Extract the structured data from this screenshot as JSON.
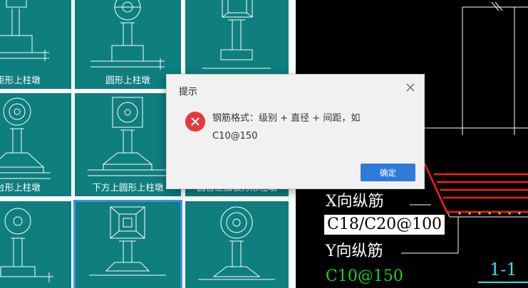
{
  "gallery": {
    "tiles": [
      {
        "label": "矩形上柱墩"
      },
      {
        "label": "圆形上柱墩"
      },
      {
        "label": ""
      },
      {
        "label": "台形上柱墩"
      },
      {
        "label": "下方上圆形上柱墩"
      },
      {
        "label": "圆台上加板方形柱墩"
      },
      {
        "label": ""
      },
      {
        "label": ""
      },
      {
        "label": ""
      }
    ],
    "selected_index": 7
  },
  "cad": {
    "x_bar_label": "X向纵筋",
    "x_bar_value": "C18/C20@100",
    "y_bar_label": "Y向纵筋",
    "y_bar_value": "C10@150",
    "section_label": "1-1",
    "colors": {
      "rebar": "#ff1a1a",
      "rebar_value": "#19d419",
      "dots": "#ffe600",
      "section": "#29e6f0"
    }
  },
  "dialog": {
    "title": "提示",
    "message_line1": "钢筋格式：级别 + 直径 + 间距，如",
    "message_line2": "C10@150",
    "ok_label": "确定",
    "icon": "error-icon",
    "close_icon": "close-icon"
  }
}
